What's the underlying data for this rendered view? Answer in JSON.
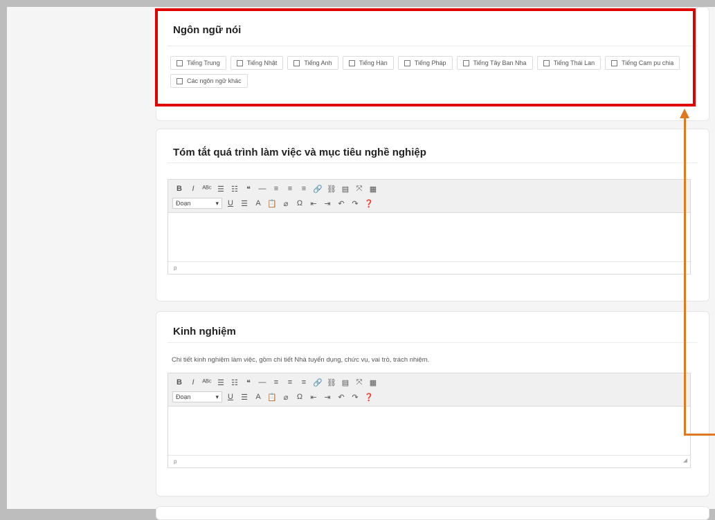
{
  "languages_section": {
    "title": "Ngôn ngữ nói",
    "options": [
      "Tiếng Trung",
      "Tiếng Nhật",
      "Tiếng Anh",
      "Tiếng Hàn",
      "Tiếng Pháp",
      "Tiếng Tây Ban Nha",
      "Tiếng Thái Lan",
      "Tiếng Cam pu chia",
      "Các ngôn ngữ khác"
    ]
  },
  "summary_section": {
    "title": "Tóm tắt quá trình làm việc và mục tiêu nghề nghiệp",
    "format_value": "Đoạn",
    "status_path": "p"
  },
  "experience_section": {
    "title": "Kinh nghiệm",
    "description": "Chi tiết kinh nghiệm làm việc, gồm chi tiết Nhà tuyển dụng, chức vụ, vai trò, trách nhiệm.",
    "format_value": "Đoạn",
    "status_path": "p"
  },
  "toolbar": {
    "row1": [
      "bold-icon:B",
      "italic-icon:I",
      "strikethrough-icon:ᴬᴮᶜ",
      "bullet-list-icon:☰",
      "numbered-list-icon:☷",
      "blockquote-icon:❝",
      "horizontal-rule-icon:—",
      "align-left-icon:≡",
      "align-center-icon:≡",
      "align-right-icon:≡",
      "link-icon:🔗",
      "unlink-icon:⛓",
      "read-more-icon:▤",
      "fullscreen-icon:⤧",
      "toolbar-toggle-icon:▦"
    ],
    "row2": [
      "underline-icon:U",
      "justify-icon:☰",
      "text-color-icon:A",
      "paste-text-icon:📋",
      "clear-format-icon:⌀",
      "special-char-icon:Ω",
      "outdent-icon:⇤",
      "indent-icon:⇥",
      "undo-icon:↶",
      "redo-icon:↷",
      "help-icon:❓"
    ]
  },
  "annotation_colors": {
    "highlight_box": "#e00000",
    "arrow": "#e07820"
  }
}
